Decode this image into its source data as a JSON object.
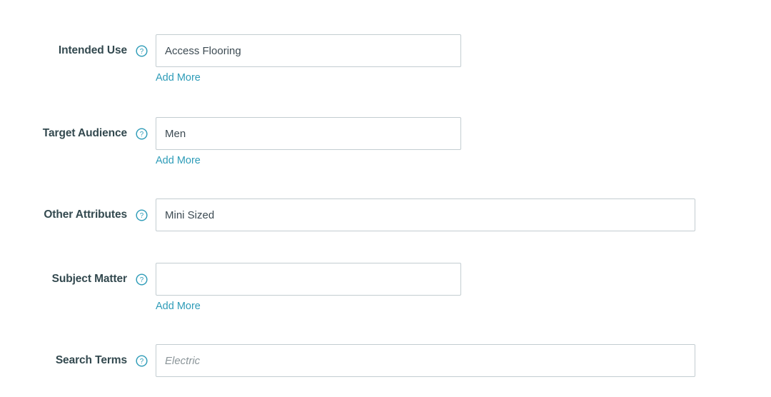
{
  "form": {
    "add_more_label": "Add More",
    "help_icon": "help-circle-icon",
    "accent_color": "#2e9cb8",
    "label_color": "#33494f",
    "input_border_color": "#c3cdd1",
    "fields": [
      {
        "label": "Intended Use",
        "value": "Access Flooring",
        "placeholder": "",
        "width": "narrow",
        "has_add_more": true
      },
      {
        "label": "Target Audience",
        "value": "Men",
        "placeholder": "",
        "width": "narrow",
        "has_add_more": true
      },
      {
        "label": "Other Attributes",
        "value": "Mini Sized",
        "placeholder": "",
        "width": "wide",
        "has_add_more": false
      },
      {
        "label": "Subject Matter",
        "value": "",
        "placeholder": "",
        "width": "narrow",
        "has_add_more": true
      },
      {
        "label": "Search Terms",
        "value": "",
        "placeholder": "Electric",
        "width": "wide",
        "has_add_more": false
      }
    ]
  }
}
